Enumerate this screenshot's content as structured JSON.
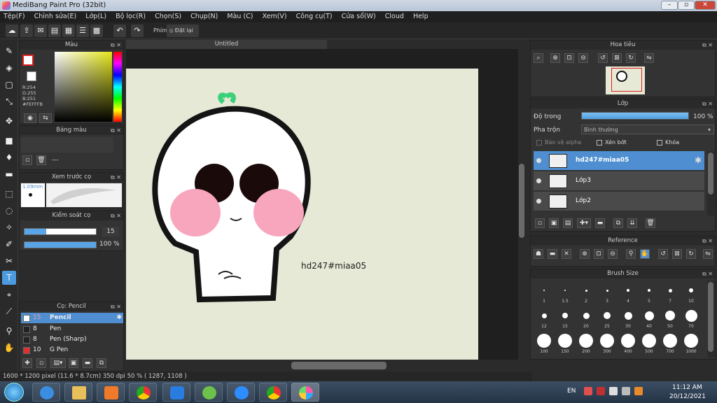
{
  "window": {
    "title": "MediBang Paint Pro (32bit)",
    "minimize": "–",
    "restore": "▫",
    "close": "✕"
  },
  "menu": [
    "Tệp(F)",
    "Chỉnh sửa(E)",
    "Lớp(L)",
    "Bộ lọc(R)",
    "Chọn(S)",
    "Chụp(N)",
    "Màu (C)",
    "Xem(V)",
    "Công cụ(T)",
    "Cửa sổ(W)",
    "Cloud",
    "Help"
  ],
  "toolbar": {
    "phim_label": "Phím",
    "reset_label": "Đặt lại"
  },
  "document_tab": "Untitled",
  "color_panel": {
    "title": "Màu",
    "r": "R:254",
    "g": "G:255",
    "b": "B:251",
    "hex": "#FEFFFB"
  },
  "palette_panel": {
    "title": "Bảng màu",
    "value": "---"
  },
  "brush_preview": {
    "title": "Xem trước cọ",
    "size": "1.09mm"
  },
  "brush_control": {
    "title": "Kiểm soát cọ",
    "size": "15",
    "opacity": "100 %",
    "size_fraction": 0.3,
    "opacity_fraction": 1.0
  },
  "brush_list": {
    "title": "Cọ: Pencil",
    "items": [
      {
        "size": "15",
        "name": "Pencil",
        "color": "#ffffff"
      },
      {
        "size": "8",
        "name": "Pen",
        "color": "#222222"
      },
      {
        "size": "8",
        "name": "Pen (Sharp)",
        "color": "#222222"
      },
      {
        "size": "10",
        "name": "G Pen",
        "color": "#e03030"
      }
    ]
  },
  "canvas_text": "hd247#miaa05",
  "navigator": {
    "title": "Hoa tiêu"
  },
  "layer_panel": {
    "title": "Lớp",
    "opacity_label": "Độ trong",
    "opacity_value": "100 %",
    "opacity_fraction": 1.0,
    "blend_label": "Pha trộn",
    "blend_value": "Bình thường",
    "protect_alpha": "Bảo vệ alpha",
    "clipping": "Xén bớt",
    "lock": "Khóa",
    "layers": [
      {
        "name": "hd247#miaa05",
        "selected": true
      },
      {
        "name": "Lớp3",
        "selected": false
      },
      {
        "name": "Lớp2",
        "selected": false
      }
    ]
  },
  "reference_panel": {
    "title": "Reference"
  },
  "brush_size_panel": {
    "title": "Brush Size",
    "sizes": [
      "1",
      "1.5",
      "2",
      "3",
      "4",
      "5",
      "7",
      "10",
      "12",
      "15",
      "20",
      "25",
      "30",
      "40",
      "50",
      "70",
      "100",
      "150",
      "200",
      "300",
      "400",
      "500",
      "700",
      "1000"
    ]
  },
  "status": {
    "dimensions": "1600 * 1200 pixel",
    "physical": "(11.6 * 8.7cm)",
    "dpi": "350 dpi",
    "zoom": "50 %",
    "coords": "( 1287, 1108 )"
  },
  "taskbar": {
    "lang": "EN",
    "time": "11:12 AM",
    "date": "20/12/2021"
  }
}
